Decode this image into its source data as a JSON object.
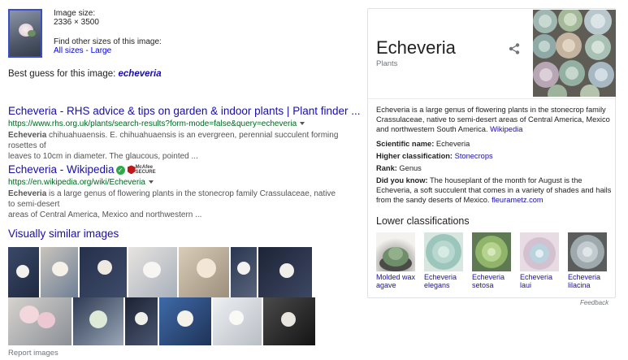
{
  "image_info": {
    "size_label": "Image size:",
    "size_value": "2336 × 3500",
    "other_sizes_label": "Find other sizes of this image:",
    "all_sizes_link": "All sizes",
    "separator": " - ",
    "large_link": "Large"
  },
  "best_guess": {
    "label": "Best guess for this image: ",
    "query": "echeveria"
  },
  "results": [
    {
      "title": "Echeveria - RHS advice & tips on garden & indoor plants | Plant finder ...",
      "url": "https://www.rhs.org.uk/plants/search-results?form-mode=false&query=echeveria",
      "snippet_bold": "Echeveria",
      "snippet_line1": " chihuahuaensis. E. chihuahuaensis is an evergreen, perennial succulent forming rosettes of",
      "snippet_line2": "leaves to 10cm in diameter. The glaucous, pointed ..."
    },
    {
      "title": "Echeveria - Wikipedia",
      "badge_check": "✓",
      "mcafee_line1": "McAfee",
      "mcafee_line2": "SECURE",
      "url": "https://en.wikipedia.org/wiki/Echeveria",
      "snippet_bold": "Echeveria",
      "snippet_line1": " is a large genus of flowering plants in the stonecrop family Crassulaceae, native to semi-desert",
      "snippet_line2": "areas of Central America, Mexico and northwestern ..."
    }
  ],
  "visually_similar_title": "Visually similar images",
  "report_images": "Report images",
  "knowledge_panel": {
    "title": "Echeveria",
    "subtitle": "Plants",
    "description": "Echeveria is a large genus of flowering plants in the stonecrop family Crassulaceae, native to semi-desert areas of Central America, Mexico and northwestern South America. ",
    "description_link": "Wikipedia",
    "facts": [
      {
        "label": "Scientific name:",
        "value": " Echeveria",
        "link": ""
      },
      {
        "label": "Higher classification:",
        "value": " ",
        "link": "Stonecrops"
      },
      {
        "label": "Rank:",
        "value": " Genus",
        "link": ""
      },
      {
        "label": "Did you know:",
        "value": " The houseplant of the month for August is the Echeveria, a soft succulent that comes in a variety of shades and hails from the sandy deserts of Mexico. ",
        "link": "fleurametz.com"
      }
    ],
    "lower_title": "Lower classifications",
    "lower": [
      {
        "line1": "Molded wax",
        "line2": "agave"
      },
      {
        "line1": "Echeveria",
        "line2": "elegans"
      },
      {
        "line1": "Echeveria",
        "line2": "setosa"
      },
      {
        "line1": "Echeveria",
        "line2": "laui"
      },
      {
        "line1": "Echeveria",
        "line2": "lilacina"
      }
    ]
  },
  "feedback": "Feedback",
  "colors": {
    "link": "#1a0dab",
    "url_green": "#006621",
    "snippet_gray": "#545454",
    "verified_green": "#2eaa4a"
  },
  "icons": [
    "share-icon",
    "verified-check-icon",
    "mcafee-secure-icon",
    "dropdown-caret-icon"
  ]
}
